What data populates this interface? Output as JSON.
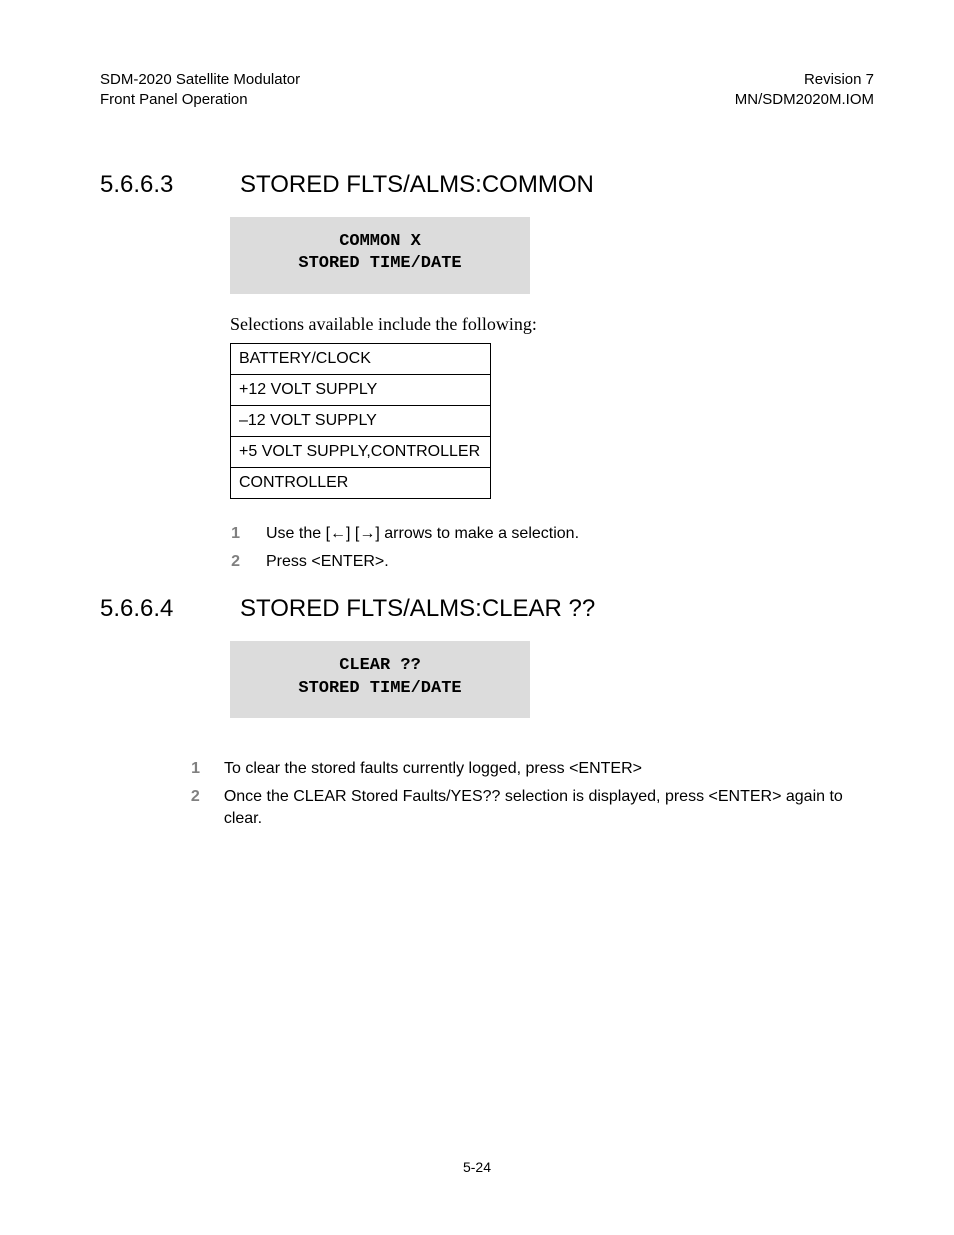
{
  "header": {
    "leftLine1": "SDM-2020 Satellite Modulator",
    "leftLine2": "Front Panel Operation",
    "rightLine1": "Revision 7",
    "rightLine2": "MN/SDM2020M.IOM"
  },
  "section1": {
    "number": "5.6.6.3",
    "title": "STORED FLTS/ALMS:COMMON",
    "displayLine1": "COMMON    X",
    "displayLine2": "STORED TIME/DATE",
    "intro": "Selections available include the following:",
    "options": [
      "BATTERY/CLOCK",
      "+12 VOLT SUPPLY",
      "–12 VOLT SUPPLY",
      "+5 VOLT SUPPLY,CONTROLLER",
      "CONTROLLER"
    ],
    "steps": [
      {
        "n": "1",
        "t": "Use the [←] [→] arrows to make a selection."
      },
      {
        "n": "2",
        "t": "Press <ENTER>."
      }
    ]
  },
  "section2": {
    "number": "5.6.6.4",
    "title": "STORED FLTS/ALMS:CLEAR ??",
    "displayLine1": "CLEAR ??",
    "displayLine2": "STORED TIME/DATE",
    "steps": [
      {
        "n": "1",
        "t": "To clear the stored faults currently logged, press <ENTER>"
      },
      {
        "n": "2",
        "t": "Once the CLEAR Stored Faults/YES?? selection is displayed, press <ENTER> again to clear."
      }
    ]
  },
  "footer": {
    "pageNum": "5-24"
  }
}
